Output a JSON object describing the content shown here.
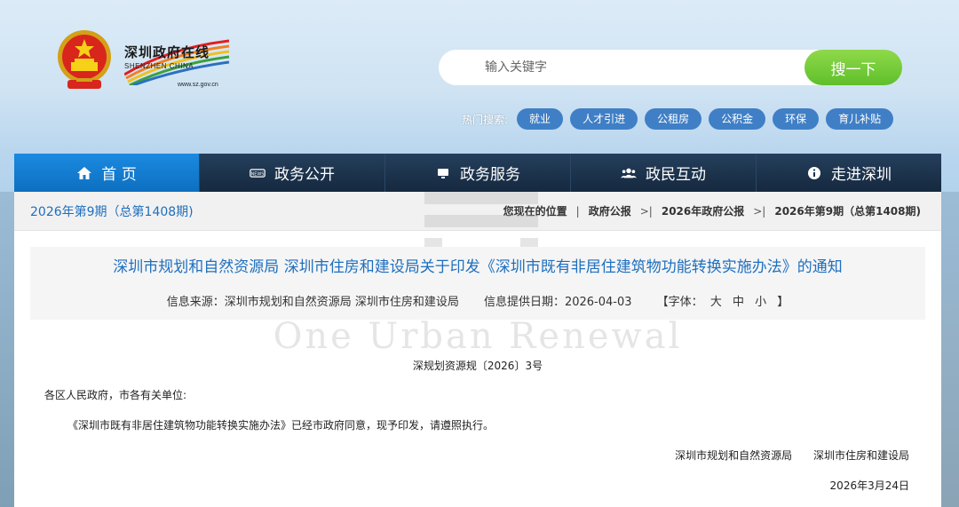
{
  "logo": {
    "cn_name": "深圳政府在线",
    "en_name": "SHENZHEN CHINA",
    "url": "www.sz.gov.cn"
  },
  "search": {
    "placeholder": "输入关键字",
    "button_label": "搜一下"
  },
  "hot_search": {
    "label": "热门搜索:",
    "tags": [
      "就业",
      "人才引进",
      "公租房",
      "公积金",
      "环保",
      "育儿补贴"
    ]
  },
  "nav": {
    "items": [
      {
        "label": "首 页",
        "icon": "home-icon"
      },
      {
        "label": "政务公开",
        "icon": "news-icon"
      },
      {
        "label": "政务服务",
        "icon": "monitor-icon"
      },
      {
        "label": "政民互动",
        "icon": "people-icon"
      },
      {
        "label": "走进深圳",
        "icon": "info-icon"
      }
    ]
  },
  "issue_label": "2026年第9期（总第1408期)",
  "breadcrumb": {
    "prefix": "您现在的位置",
    "items": [
      "政府公报",
      "2026年政府公报",
      "2026年第9期（总第1408期)"
    ]
  },
  "document": {
    "title": "深圳市规划和自然资源局 深圳市住房和建设局关于印发《深圳市既有非居住建筑物功能转换实施办法》的通知",
    "source": "信息来源：深圳市规划和自然资源局 深圳市住房和建设局",
    "date_provided": "信息提供日期：2026-04-03",
    "font_label_open": "【字体：",
    "font_sizes": [
      "大",
      "中",
      "小"
    ],
    "font_label_close": "】",
    "doc_number": "深规划资源规〔2026〕3号",
    "salutation": "各区人民政府，市各有关单位:",
    "body": "《深圳市既有非居住建筑物功能转换实施办法》已经市政府同意，现予印发，请遵照执行。",
    "signers": [
      "深圳市规划和自然资源局",
      "深圳市住房和建设局"
    ],
    "sign_date": "2026年3月24日"
  },
  "watermark": {
    "text": "One Urban Renewal"
  },
  "colors": {
    "nav_active": "#1a8ae0",
    "nav_bg": "#17304c",
    "link_blue": "#1e6fbf",
    "search_button": "#6cc832"
  }
}
